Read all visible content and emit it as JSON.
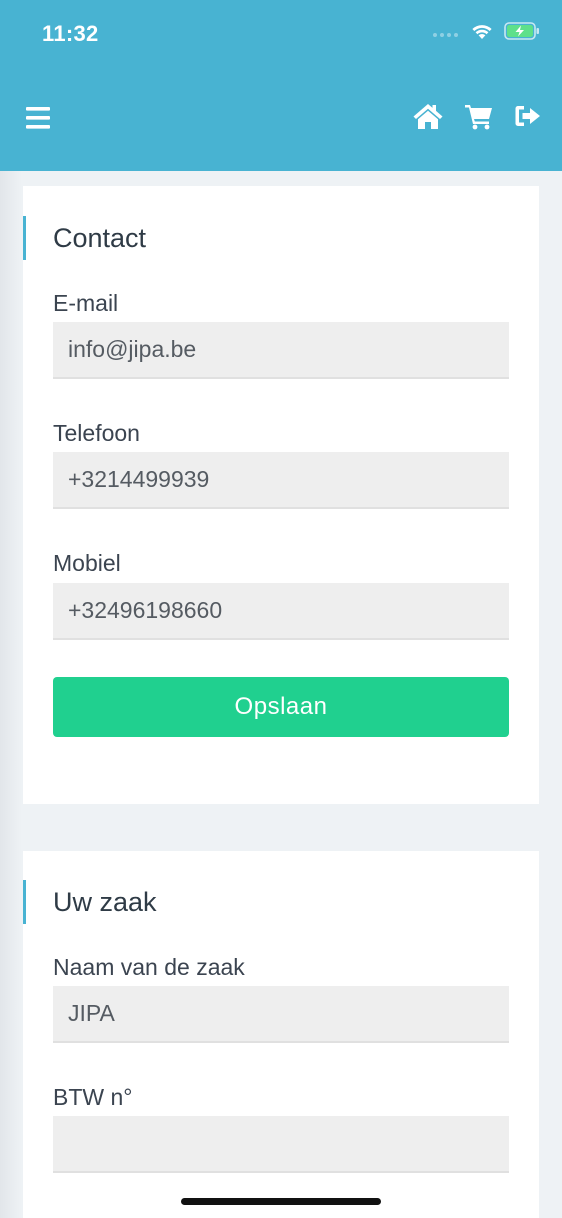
{
  "status_bar": {
    "time": "11:32",
    "icons": [
      "signal-dots-icon",
      "wifi-icon",
      "battery-charging-icon"
    ]
  },
  "header": {
    "color": "#48b3d2",
    "left_icon": "menu-icon",
    "right_icons": [
      "home-icon",
      "cart-icon",
      "logout-icon"
    ]
  },
  "contact": {
    "title": "Contact",
    "email_label": "E-mail",
    "email_value": "info@jipa.be",
    "phone_label": "Telefoon",
    "phone_value": "+3214499939",
    "mobile_label": "Mobiel",
    "mobile_value": "+32496198660",
    "save_label": "Opslaan"
  },
  "business": {
    "title": "Uw zaak",
    "name_label": "Naam van de zaak",
    "name_value": "JIPA",
    "vat_label": "BTW n°",
    "vat_value": ""
  },
  "colors": {
    "accent": "#48b3d2",
    "save_button": "#20d08f",
    "background": "#eef2f5",
    "input_bg": "#eeeeee"
  }
}
